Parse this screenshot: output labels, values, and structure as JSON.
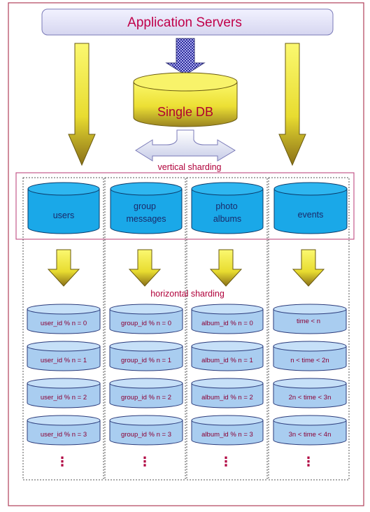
{
  "title": "Application  Servers",
  "single_db": "Single DB",
  "vertical_label": "vertical sharding",
  "horizontal_label": "horizontal sharding",
  "ellipsis": "⋮",
  "columns": [
    {
      "name_line1": "users",
      "name_line2": "",
      "shards": [
        "user_id % n = 0",
        "user_id % n = 1",
        "user_id % n = 2",
        "user_id % n = 3"
      ]
    },
    {
      "name_line1": "group",
      "name_line2": "messages",
      "shards": [
        "group_id % n = 0",
        "group_id % n = 1",
        "group_id % n = 2",
        "group_id % n = 3"
      ]
    },
    {
      "name_line1": "photo",
      "name_line2": "albums",
      "shards": [
        "album_id % n = 0",
        "album_id % n = 1",
        "album_id % n = 2",
        "album_id % n = 3"
      ]
    },
    {
      "name_line1": "events",
      "name_line2": "",
      "shards": [
        "time < n",
        "n < time < 2n",
        "2n < time < 3n",
        "3n < time < 4n"
      ]
    }
  ],
  "colors": {
    "frame": "#b0405a",
    "title_fill": "#e6e6f8",
    "arrow_yellow": "#f2e83a",
    "db_yellow": "#f4ec3a",
    "db_cyan": "#1aa8e8",
    "shard_blue": "#a9cdf0"
  }
}
